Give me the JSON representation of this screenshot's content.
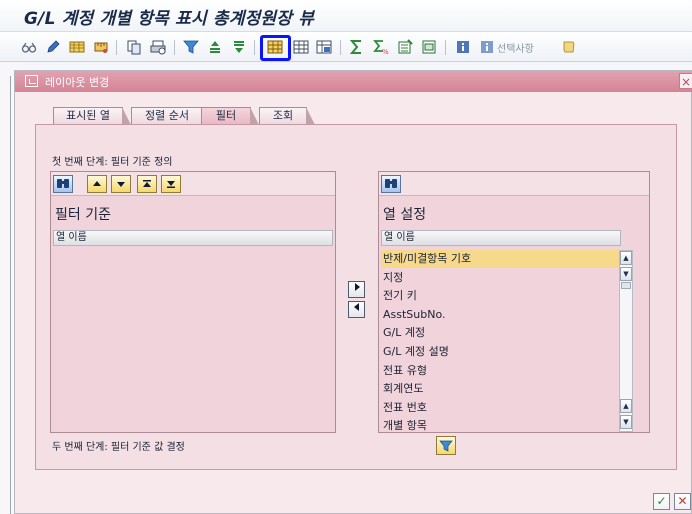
{
  "window": {
    "title": "G/L 계정 개별 항목 표시 총계정원장 뷰"
  },
  "toolbar": {
    "selection_label": "선택사항",
    "icons": [
      "glasses-icon",
      "pencil-icon",
      "table-edit-icon",
      "ruler-icon",
      "copy-icon",
      "print-icon",
      "filter-icon",
      "sort-ascending-icon",
      "sort-descending-icon",
      "layout-grid-icon",
      "select-layout-icon",
      "save-layout-icon",
      "sum-icon",
      "subtotal-icon",
      "export-icon",
      "abc-icon",
      "info-icon",
      "info2-icon",
      "scroll-icon"
    ]
  },
  "dialog": {
    "title": "레이아웃 변경",
    "close": "×",
    "tabs": [
      {
        "label": "표시된 열"
      },
      {
        "label": "정렬 순서"
      },
      {
        "label": "필터"
      },
      {
        "label": "조회"
      }
    ],
    "active_tab": "필터",
    "step1": "첫 번째 단계: 필터 기준 정의",
    "step2": "두 번째 단계: 필터 기준 값 결정"
  },
  "left_list": {
    "title": "필터 기준",
    "column_header": "열 이름",
    "rows": []
  },
  "right_list": {
    "title": "열 설정",
    "column_header": "열 이름",
    "rows": [
      {
        "label": "반제/미결항목 기호",
        "selected": true
      },
      {
        "label": "지정",
        "selected": false
      },
      {
        "label": "전기 키",
        "selected": false
      },
      {
        "label": "AsstSubNo.",
        "selected": false
      },
      {
        "label": "G/L 계정",
        "selected": false
      },
      {
        "label": "G/L 계정 설명",
        "selected": false
      },
      {
        "label": "전표 유형",
        "selected": false
      },
      {
        "label": "회계연도",
        "selected": false
      },
      {
        "label": "전표 번호",
        "selected": false
      },
      {
        "label": "개별 항목",
        "selected": false
      }
    ]
  },
  "colors": {
    "dialog_header": "#d38496",
    "panel": "#f3dfe4",
    "list": "#f1d4db",
    "selected_row": "#f7d98c",
    "highlight": "#0b14ff"
  }
}
